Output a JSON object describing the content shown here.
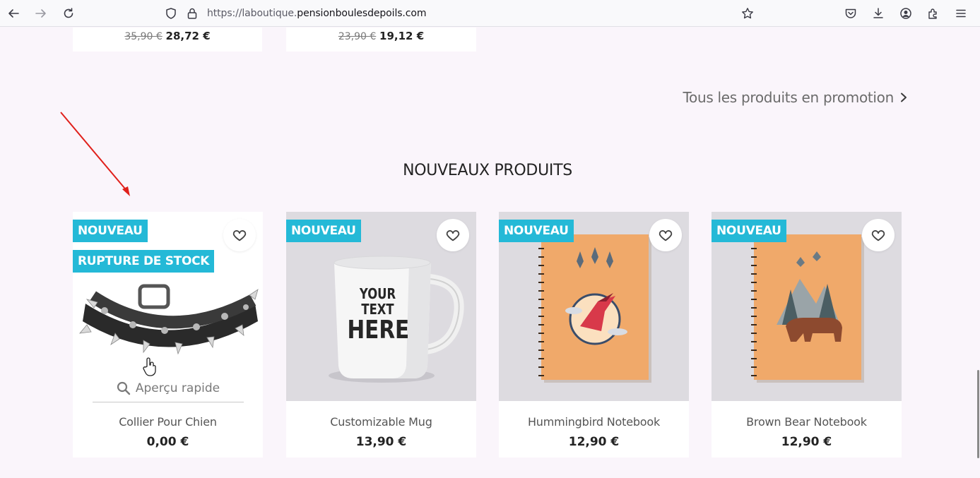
{
  "browser": {
    "url_prefix": "https://laboutique.",
    "url_domain": "pensionboulesdepoils.com"
  },
  "top_products": [
    {
      "old_price": "35,90 €",
      "new_price": "28,72 €"
    },
    {
      "old_price": "23,90 €",
      "new_price": "19,12 €"
    }
  ],
  "promo_link": "Tous les produits en promotion",
  "section_title": "NOUVEAUX PRODUITS",
  "quick_view_label": "Aperçu rapide",
  "products": [
    {
      "name": "Collier Pour Chien",
      "price": "0,00 €",
      "badges": [
        "NOUVEAU",
        "RUPTURE DE STOCK"
      ]
    },
    {
      "name": "Customizable Mug",
      "price": "13,90 €",
      "badges": [
        "NOUVEAU"
      ],
      "image_text": [
        "YOUR TEXT",
        "HERE"
      ]
    },
    {
      "name": "Hummingbird Notebook",
      "price": "12,90 €",
      "badges": [
        "NOUVEAU"
      ]
    },
    {
      "name": "Brown Bear Notebook",
      "price": "12,90 €",
      "badges": [
        "NOUVEAU"
      ]
    }
  ],
  "colors": {
    "badge": "#24b9d7",
    "annotation_arrow": "#e0201b"
  },
  "icons": [
    "back-icon",
    "forward-icon",
    "reload-icon",
    "shield-icon",
    "lock-icon",
    "star-icon",
    "pocket-icon",
    "download-icon",
    "account-icon",
    "extensions-icon",
    "menu-icon",
    "heart-icon",
    "search-icon",
    "chevron-right-icon"
  ]
}
